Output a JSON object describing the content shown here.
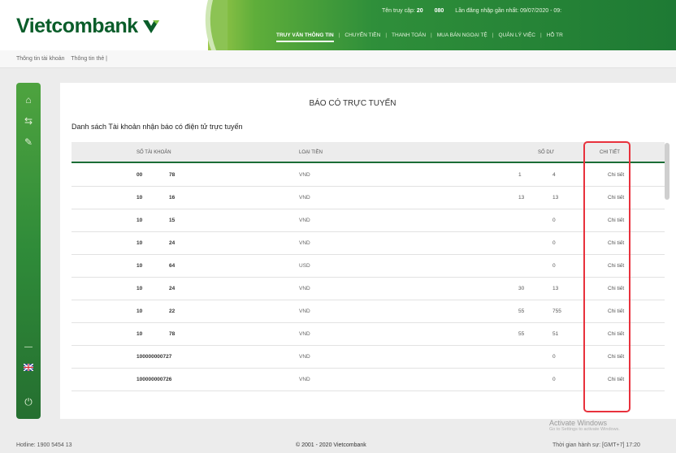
{
  "brand": {
    "name": "Vietcombank",
    "accent": "#0a5d2a",
    "green": "#2f8f3a"
  },
  "top_info": {
    "login_label": "Tên truy cập:",
    "login_value": "20",
    "user_value": "080",
    "last_login": "Lần đăng nhập gần nhất: 09/07/2020 - 09:"
  },
  "nav": {
    "items": [
      "TRUY VẤN THÔNG TIN",
      "CHUYỂN TIỀN",
      "THANH TOÁN",
      "MUA BÁN NGOẠI TỆ",
      "QUẢN LÝ VIỆC",
      "HỖ TR"
    ]
  },
  "subbar": {
    "items": [
      "Thông tin tài khoản",
      "Thông tin thẻ |"
    ]
  },
  "sidebar": {
    "icons": [
      "home-icon",
      "transfer-icon",
      "tools-icon",
      "flag-icon",
      "power-icon"
    ]
  },
  "content": {
    "title": "BÁO CÓ TRỰC TUYẾN",
    "subtitle": "Danh sách Tài khoản nhận báo có điện tử trực tuyến",
    "columns": [
      "SỐ TÀI KHOẢN",
      "LOẠI TIỀN",
      "SỐ DƯ",
      "CHI TIẾT"
    ],
    "rows": [
      {
        "acc1": "00",
        "acc2": "78",
        "currency": "VND",
        "bal1": "1",
        "bal2": "4",
        "detail": "Chi tiết"
      },
      {
        "acc1": "10",
        "acc2": "16",
        "currency": "VND",
        "bal1": "13",
        "bal2": "13",
        "detail": "Chi tiết"
      },
      {
        "acc1": "10",
        "acc2": "15",
        "currency": "VND",
        "bal1": "",
        "bal2": "0",
        "detail": "Chi tiết"
      },
      {
        "acc1": "10",
        "acc2": "24",
        "currency": "VND",
        "bal1": "",
        "bal2": "0",
        "detail": "Chi tiết"
      },
      {
        "acc1": "10",
        "acc2": "64",
        "currency": "USD",
        "bal1": "",
        "bal2": "0",
        "detail": "Chi tiết"
      },
      {
        "acc1": "10",
        "acc2": "24",
        "currency": "VND",
        "bal1": "30",
        "bal2": "13",
        "detail": "Chi tiết"
      },
      {
        "acc1": "10",
        "acc2": "22",
        "currency": "VND",
        "bal1": "55",
        "bal2": "755",
        "detail": "Chi tiết"
      },
      {
        "acc1": "10",
        "acc2": "78",
        "currency": "VND",
        "bal1": "55",
        "bal2": "51",
        "detail": "Chi tiết"
      },
      {
        "acc1": "100000000727",
        "acc2": "",
        "currency": "VND",
        "bal1": "",
        "bal2": "0",
        "detail": "Chi tiết"
      },
      {
        "acc1": "100000000726",
        "acc2": "",
        "currency": "VND",
        "bal1": "",
        "bal2": "0",
        "detail": "Chi tiết"
      }
    ]
  },
  "watermark": {
    "title": "Activate Windows",
    "hint": "Go to Settings to activate Windows."
  },
  "footer": {
    "hotline": "Hotline: 1900 5454 13",
    "copyright": "© 2001 - 2020 Vietcombank",
    "time": "Thời gian hành sự: [GMT+7]  17:20"
  }
}
